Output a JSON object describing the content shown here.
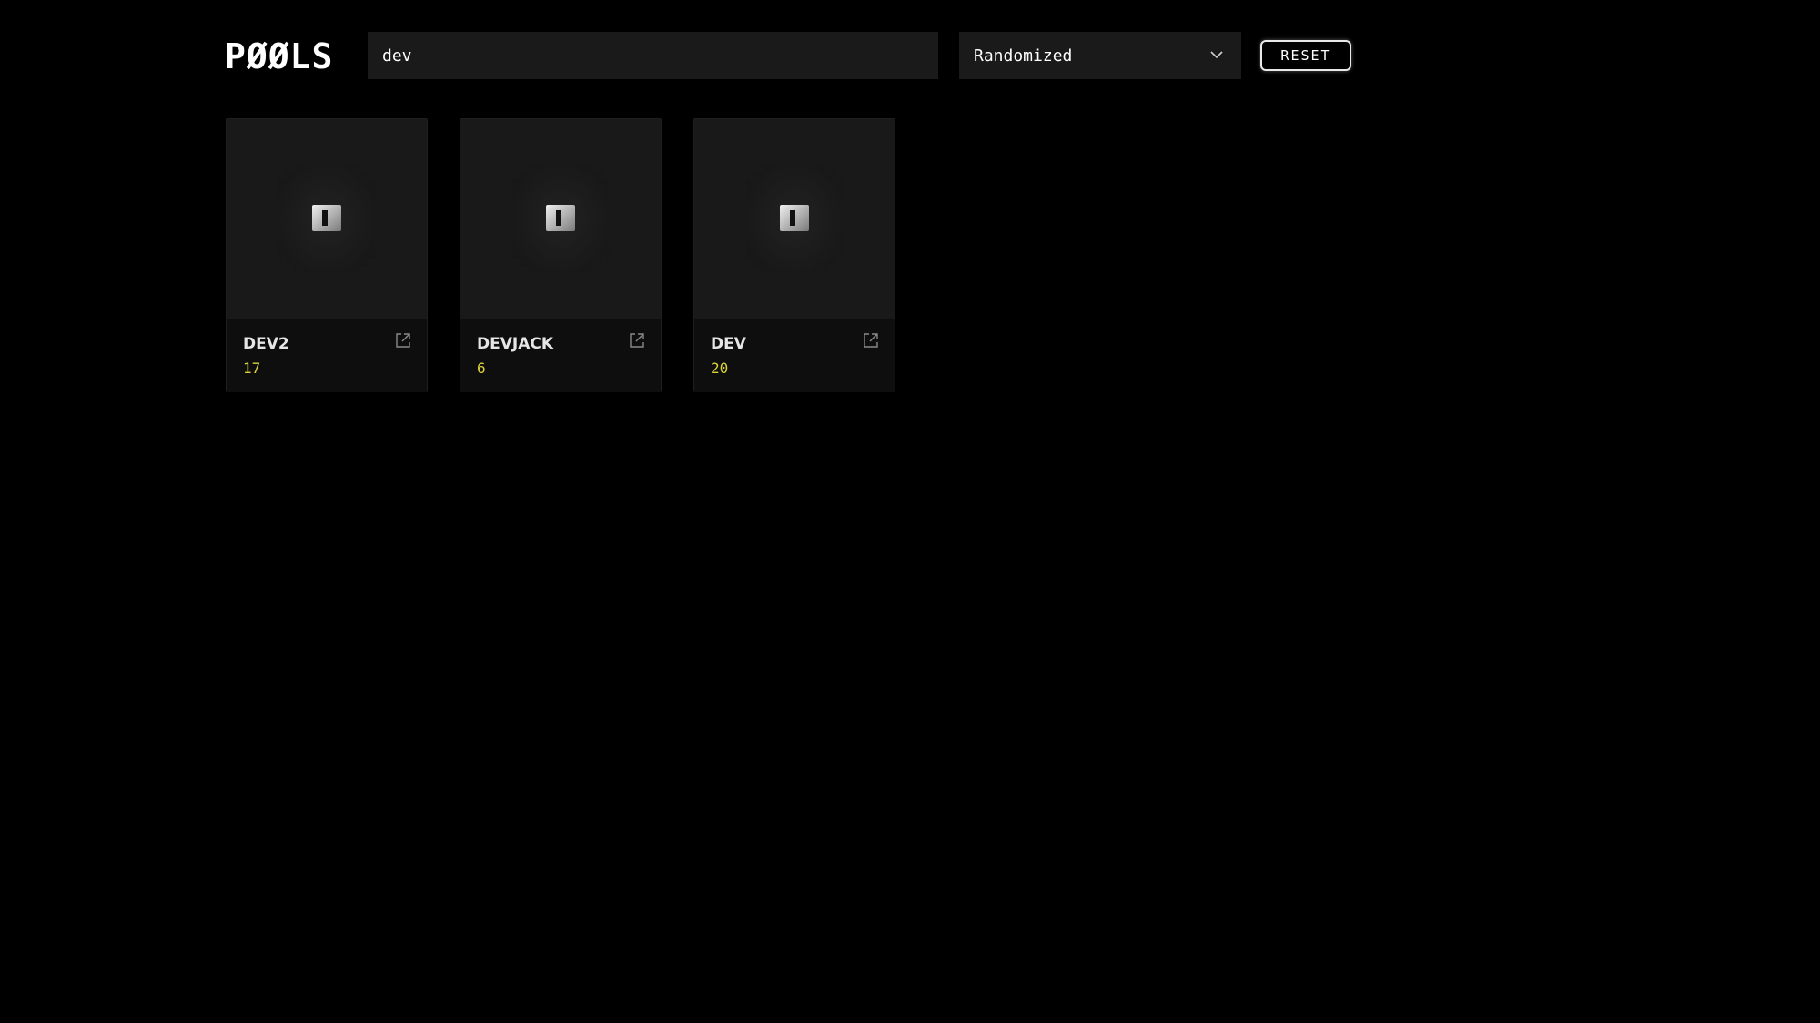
{
  "header": {
    "logo": "PØØLS",
    "search": {
      "value": "dev",
      "placeholder": ""
    },
    "sort": {
      "selected": "Randomized"
    },
    "reset_label": "RESET"
  },
  "pools": [
    {
      "name": "DEV2",
      "count": "17",
      "icon": "external-link-icon"
    },
    {
      "name": "DEVJACK",
      "count": "6",
      "icon": "external-link-icon"
    },
    {
      "name": "DEV",
      "count": "20",
      "icon": "external-link-icon"
    }
  ],
  "colors": {
    "background": "#000000",
    "panel": "#1a1a1a",
    "count": "#d9d23a",
    "text": "#e6e6e6"
  }
}
